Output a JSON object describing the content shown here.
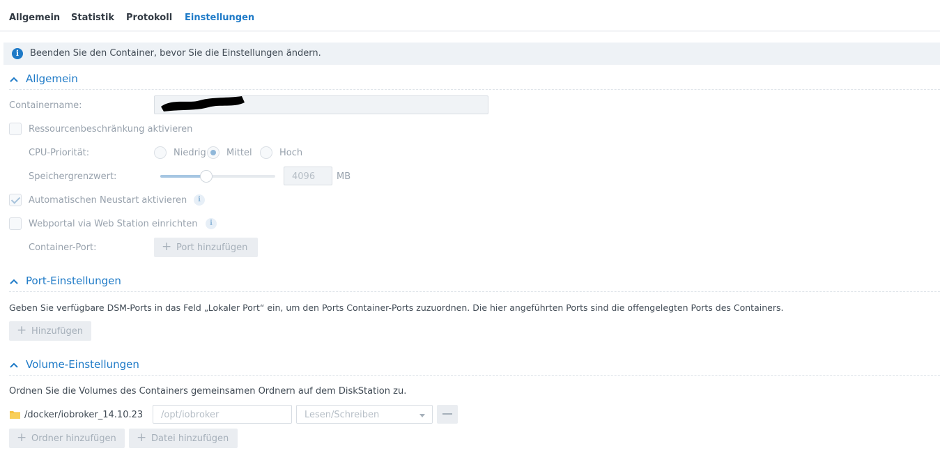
{
  "tabs": [
    {
      "label": "Allgemein"
    },
    {
      "label": "Statistik"
    },
    {
      "label": "Protokoll"
    },
    {
      "label": "Einstellungen"
    }
  ],
  "notice": {
    "text": "Beenden Sie den Container, bevor Sie die Einstellungen ändern.",
    "icon": "info-icon"
  },
  "general": {
    "title": "Allgemein",
    "container_name_label": "Containername:",
    "container_name_value": "",
    "resource_limit_label": "Ressourcenbeschränkung aktivieren",
    "resource_limit_checked": false,
    "cpu_priority_label": "CPU-Priorität:",
    "cpu_options": [
      {
        "label": "Niedrig",
        "selected": false
      },
      {
        "label": "Mittel",
        "selected": true
      },
      {
        "label": "Hoch",
        "selected": false
      }
    ],
    "memory_label": "Speichergrenzwert:",
    "memory_value": "4096",
    "memory_unit": "MB",
    "memory_slider_fraction": 0.4,
    "auto_restart_label": "Automatischen Neustart aktivieren",
    "auto_restart_checked": true,
    "webportal_label": "Webportal via Web Station einrichten",
    "webportal_checked": false,
    "container_port_label": "Container-Port:",
    "add_port_button": "Port hinzufügen"
  },
  "ports": {
    "title": "Port-Einstellungen",
    "description": "Geben Sie verfügbare DSM-Ports in das Feld „Lokaler Port“ ein, um den Ports Container-Ports zuzuordnen. Die hier angeführten Ports sind die offengelegten Ports des Containers.",
    "add_button": "Hinzufügen"
  },
  "volumes": {
    "title": "Volume-Einstellungen",
    "description": "Ordnen Sie die Volumes des Containers gemeinsamen Ordnern auf dem DiskStation zu.",
    "rows": [
      {
        "folder": "/docker/iobroker_14.10.23",
        "mount_path": "/opt/iobroker",
        "permission": "Lesen/Schreiben"
      }
    ],
    "add_folder_button": "Ordner hinzufügen",
    "add_file_button": "Datei hinzufügen"
  },
  "colors": {
    "accent": "#1e7ac7",
    "folder": "#f5c242",
    "redaction": "#000000"
  }
}
